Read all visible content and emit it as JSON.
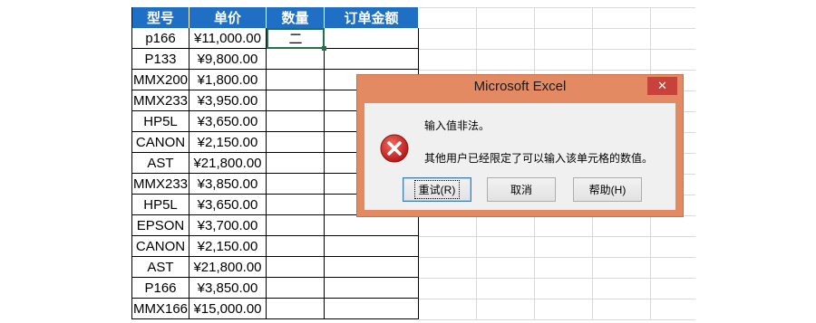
{
  "table": {
    "headers": [
      "型号",
      "单价",
      "数量",
      "订单金额"
    ],
    "rows": [
      {
        "model": "p166",
        "price": "¥11,000.00",
        "qty": "二",
        "amount": ""
      },
      {
        "model": "P133",
        "price": "¥9,800.00",
        "qty": "",
        "amount": ""
      },
      {
        "model": "MMX200",
        "price": "¥1,800.00",
        "qty": "",
        "amount": ""
      },
      {
        "model": "MMX233",
        "price": "¥3,950.00",
        "qty": "",
        "amount": ""
      },
      {
        "model": "HP5L",
        "price": "¥3,650.00",
        "qty": "",
        "amount": ""
      },
      {
        "model": "CANON",
        "price": "¥2,150.00",
        "qty": "",
        "amount": ""
      },
      {
        "model": "AST",
        "price": "¥21,800.00",
        "qty": "",
        "amount": ""
      },
      {
        "model": "MMX233",
        "price": "¥3,850.00",
        "qty": "",
        "amount": ""
      },
      {
        "model": "HP5L",
        "price": "¥3,650.00",
        "qty": "",
        "amount": ""
      },
      {
        "model": "EPSON",
        "price": "¥3,700.00",
        "qty": "",
        "amount": ""
      },
      {
        "model": "CANON",
        "price": "¥2,150.00",
        "qty": "",
        "amount": ""
      },
      {
        "model": "AST",
        "price": "¥21,800.00",
        "qty": "",
        "amount": ""
      },
      {
        "model": "P166",
        "price": "¥3,850.00",
        "qty": "",
        "amount": ""
      },
      {
        "model": "MMX166",
        "price": "¥15,000.00",
        "qty": "",
        "amount": ""
      }
    ],
    "header_color": "#1f6fc5",
    "selection_color": "#217346"
  },
  "dialog": {
    "title": "Microsoft Excel",
    "close_glyph": "✕",
    "message_line1": "输入值非法。",
    "message_line2": "其他用户已经限定了可以输入该单元格的数值。",
    "icon": "error-icon",
    "buttons": {
      "retry": "重试(R)",
      "cancel": "取消",
      "help": "帮助(H)"
    },
    "frame_color": "#e38a63"
  }
}
